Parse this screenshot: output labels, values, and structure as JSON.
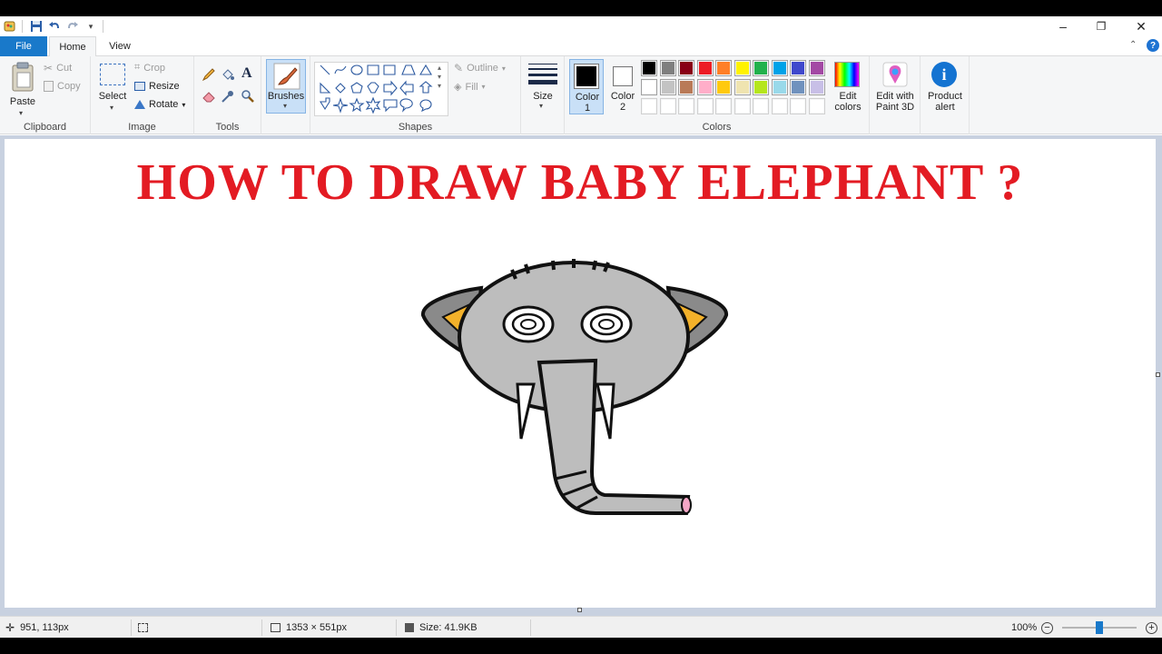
{
  "quick_access": {
    "icons": [
      "paint-app-icon",
      "save-icon",
      "undo-icon",
      "redo-icon",
      "customize-dropdown-icon"
    ]
  },
  "window_controls": {
    "minimize": "–",
    "restore": "❐",
    "close": "✕"
  },
  "tabs": {
    "file": "File",
    "home": "Home",
    "view": "View"
  },
  "ribbon": {
    "clipboard": {
      "paste": "Paste",
      "cut": "Cut",
      "copy": "Copy",
      "label": "Clipboard"
    },
    "image": {
      "select": "Select",
      "crop": "Crop",
      "resize": "Resize",
      "rotate": "Rotate",
      "label": "Image"
    },
    "tools": {
      "label": "Tools"
    },
    "brushes": {
      "label": "Brushes"
    },
    "shapes": {
      "outline": "Outline",
      "fill": "Fill",
      "label": "Shapes"
    },
    "size": {
      "label": "Size"
    },
    "colors": {
      "color1_line1": "Color",
      "color1_line2": "1",
      "color2_line1": "Color",
      "color2_line2": "2",
      "edit_line1": "Edit",
      "edit_line2": "colors",
      "label": "Colors",
      "color1_value": "#000000",
      "color2_value": "#ffffff",
      "palette_row1": [
        "#000000",
        "#7f7f7f",
        "#880015",
        "#ed1c24",
        "#ff7f27",
        "#fff200",
        "#22b14c",
        "#00a2e8",
        "#3f48cc",
        "#a349a4"
      ],
      "palette_row2": [
        "#ffffff",
        "#c3c3c3",
        "#b97a57",
        "#ffaec9",
        "#ffc90e",
        "#efe4b0",
        "#b5e61d",
        "#99d9ea",
        "#7092be",
        "#c8bfe7"
      ]
    },
    "paint3d": {
      "line1": "Edit with",
      "line2": "Paint 3D"
    },
    "product_alert": {
      "line1": "Product",
      "line2": "alert"
    }
  },
  "canvas": {
    "headline": "HOW TO DRAW BABY ELEPHANT ?"
  },
  "status": {
    "cursor_position": "951, 113px",
    "canvas_size": "1353 × 551px",
    "file_size": "Size: 41.9KB",
    "zoom": "100%",
    "zoom_level": 0.5
  }
}
